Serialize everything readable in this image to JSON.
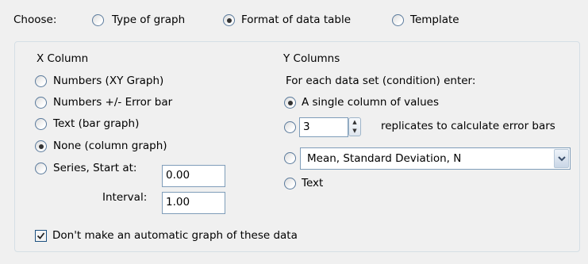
{
  "choose": {
    "label": "Choose:",
    "options": [
      {
        "label": "Type of graph",
        "checked": false
      },
      {
        "label": "Format of data table",
        "checked": true
      },
      {
        "label": "Template",
        "checked": false
      }
    ]
  },
  "x_column": {
    "heading": "X Column",
    "options": [
      {
        "label": "Numbers (XY Graph)",
        "checked": false
      },
      {
        "label": "Numbers +/- Error bar",
        "checked": false
      },
      {
        "label": "Text (bar graph)",
        "checked": false
      },
      {
        "label": "None (column graph)",
        "checked": true
      },
      {
        "label": "Series, Start at:",
        "checked": false
      }
    ],
    "start_value": "0.00",
    "interval_label": "Interval:",
    "interval_value": "1.00"
  },
  "y_columns": {
    "heading": "Y Columns",
    "instruction": "For each data set (condition) enter:",
    "single_column_label": "A single column of values",
    "single_column_checked": true,
    "replicates_value": "3",
    "replicates_label": "replicates to calculate error bars",
    "replicates_checked": false,
    "summary_select_value": "Mean, Standard Deviation, N",
    "summary_checked": false,
    "text_label": "Text",
    "text_checked": false
  },
  "no_auto_graph": {
    "label": "Don't make an automatic graph of these data",
    "checked": true
  },
  "colors": {
    "window_bg": "#f0f0f0",
    "radio_border": "#5a7a9c",
    "input_border": "#7f9db9",
    "group_border": "#d5dfe5"
  }
}
